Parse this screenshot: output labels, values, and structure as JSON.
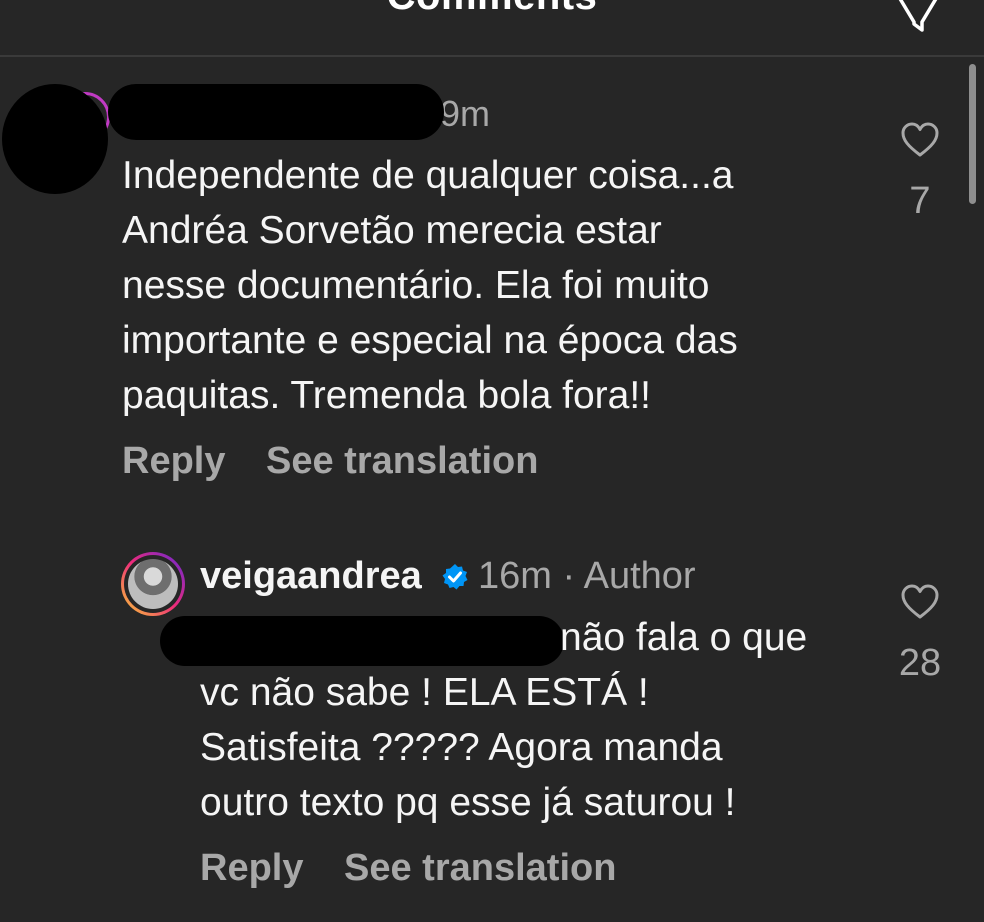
{
  "header": {
    "title": "Comments"
  },
  "comments": [
    {
      "time": "9m",
      "text": "Independente de qualquer coisa...a\nAndréa Sorvetão merecia estar\nnesse documentário. Ela foi muito\nimportante e especial na época das\npaquitas. Tremenda bola fora!!",
      "reply_label": "Reply",
      "translate_label": "See translation",
      "likes": "7"
    },
    {
      "username": "veigaandrea",
      "time": "16m",
      "separator": "·",
      "author_label": "Author",
      "text_first": "não fala o que",
      "text_rest": "vc não sabe ! ELA ESTÁ !\nSatisfeita ????? Agora manda\noutro texto pq esse já saturou !",
      "reply_label": "Reply",
      "translate_label": "See translation",
      "likes": "28"
    }
  ],
  "colors": {
    "background": "#262626",
    "text": "#f5f5f5",
    "secondary_text": "#a8a8a8",
    "verified": "#0095f6"
  }
}
